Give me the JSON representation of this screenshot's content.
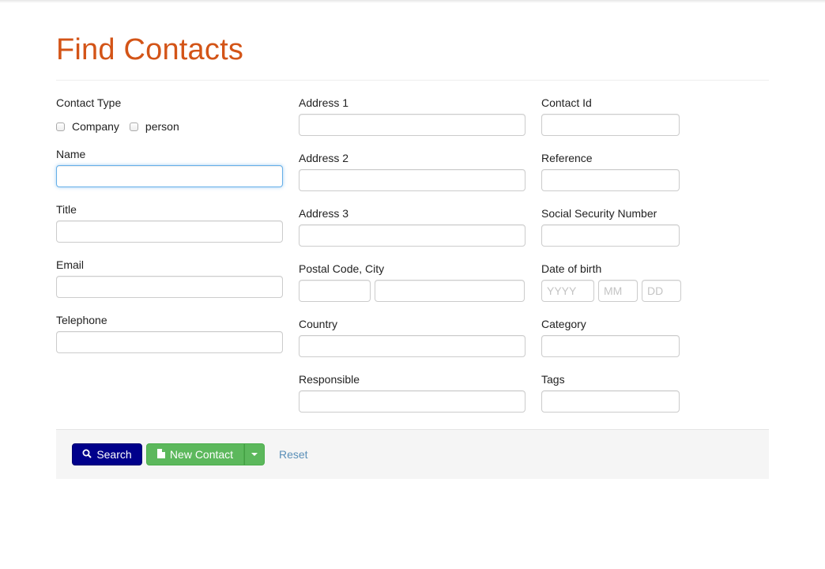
{
  "page": {
    "title": "Find Contacts"
  },
  "colors": {
    "title": "#d35417",
    "search_button": "#00008b",
    "new_button": "#5cb85c",
    "reset_link": "#5a8fb8"
  },
  "column1": {
    "contact_type": {
      "label": "Contact Type",
      "options": [
        {
          "label": "Company",
          "checked": false
        },
        {
          "label": "person",
          "checked": false
        }
      ]
    },
    "name": {
      "label": "Name",
      "value": ""
    },
    "title": {
      "label": "Title",
      "value": ""
    },
    "email": {
      "label": "Email",
      "value": ""
    },
    "telephone": {
      "label": "Telephone",
      "value": ""
    }
  },
  "column2": {
    "address1": {
      "label": "Address 1",
      "value": ""
    },
    "address2": {
      "label": "Address 2",
      "value": ""
    },
    "address3": {
      "label": "Address 3",
      "value": ""
    },
    "postal_city": {
      "label": "Postal Code, City",
      "postal_value": "",
      "city_value": ""
    },
    "country": {
      "label": "Country",
      "value": ""
    },
    "responsible": {
      "label": "Responsible",
      "value": ""
    }
  },
  "column3": {
    "contact_id": {
      "label": "Contact Id",
      "value": ""
    },
    "reference": {
      "label": "Reference",
      "value": ""
    },
    "ssn": {
      "label": "Social Security Number",
      "value": ""
    },
    "dob": {
      "label": "Date of birth",
      "year_placeholder": "YYYY",
      "month_placeholder": "MM",
      "day_placeholder": "DD"
    },
    "category": {
      "label": "Category",
      "value": ""
    },
    "tags": {
      "label": "Tags",
      "value": ""
    }
  },
  "actions": {
    "search_label": "Search",
    "search_icon": "search-icon",
    "new_contact_label": "New Contact",
    "new_contact_icon": "file-icon",
    "reset_label": "Reset"
  }
}
